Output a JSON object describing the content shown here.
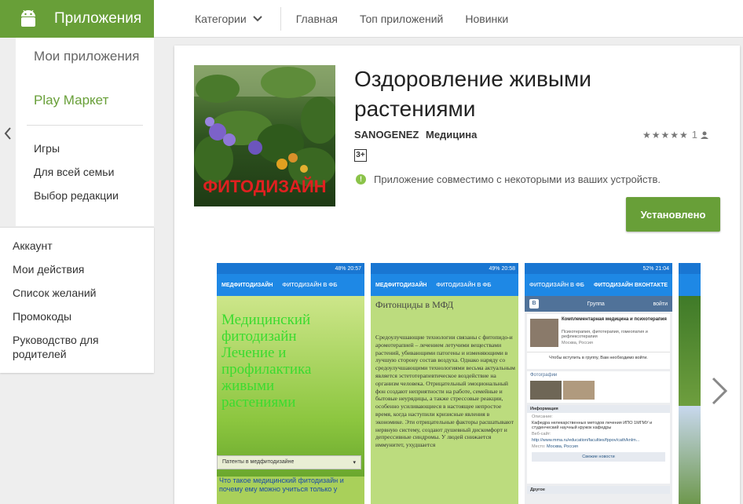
{
  "brand": {
    "title": "Приложения",
    "color": "#689f38"
  },
  "nav": {
    "categories": "Категории",
    "home": "Главная",
    "top": "Топ приложений",
    "new": "Новинки"
  },
  "sidebar": {
    "my_apps": "Мои приложения",
    "play": "Play Маркет",
    "sub": [
      "Игры",
      "Для всей семьи",
      "Выбор редакции"
    ],
    "account": [
      "Аккаунт",
      "Мои действия",
      "Список желаний",
      "Промокоды",
      "Руководство для родителей"
    ]
  },
  "app": {
    "title": "Оздоровление живыми растениями",
    "developer": "SANOGENEZ",
    "category": "Медицина",
    "rating_count": "1",
    "age": "3+",
    "compat": "Приложение совместимо с некоторыми из ваших устройств.",
    "install": "Установлено",
    "icon_caption": "ФИТОДИЗАЙН"
  },
  "shots": {
    "s1": {
      "status": "48% 20:57",
      "tab1": "МЕДФИТОДИЗАЙН",
      "tab2": "ФИТОДИЗАЙН В ФБ",
      "heading": "Медицинский фитодизайн Лечение и профилактика живыми растениями",
      "dropdown": "Патенты в медфитодизайне",
      "footer": "Что такое медицинский фитодизайн и почему ему можно учиться только у"
    },
    "s2": {
      "status": "49% 20:58",
      "tab1": "МЕДФИТОДИЗАЙН",
      "tab2": "ФИТОДИЗАЙН В ФБ",
      "heading": "Фитонциды в МФД",
      "body": "Средоулучшающие технологии связаны с фитопидо-и аромотерапией – лечением летучими веществами растений, убивающими патогены и изменяющими в лучшую сторону состав воздуха. Однако наряду со средоулучшающими технологиями весьма актуальным является эстетотерапевтическое воздействие на организм человека. Отрицательный эмоциональный фон создают неприятности на работе, семейные и бытовые неурядицы, а также стрессовые реакции, особенно усиливающиеся в настоящее непростое время, когда наступили кризисные явления в экономике. Эти отрицательные факторы расшатывают нервную систему, создают душевный дискомфорт и депрессивные синдромы. У людей снижается иммунитет, ухудшается"
    },
    "s3": {
      "status": "52% 21:04",
      "tab1": "ФИТОДИЗАЙН В ФБ",
      "tab2": "ФИТОДИЗАЙН ВКОНТАКТЕ",
      "vk_title": "Группа",
      "vk_login": "войти",
      "group_name": "Комплементарная медицина и психотерапия",
      "group_desc": "Психотерапия, фитотерапия, гомеопатия и рефлексотерапия",
      "group_city": "Москва, Россия",
      "join": "Чтобы вступить в группу, Вам необходимо войти.",
      "photos": "Фотографии",
      "info": "Информация",
      "desc_label": "Описание:",
      "desc": "Кафедра нелекарственных методов лечения ИПО 1МГМУ и студенческий научный кружок кафедры",
      "site_label": "Веб-сайт:",
      "site": "http://www.mma.ru/education/faculties/fppov/cath/knlm...",
      "place_label": "Место:",
      "place": "Москва, Россия",
      "news": "Свежие новости",
      "other": "Другое"
    }
  }
}
